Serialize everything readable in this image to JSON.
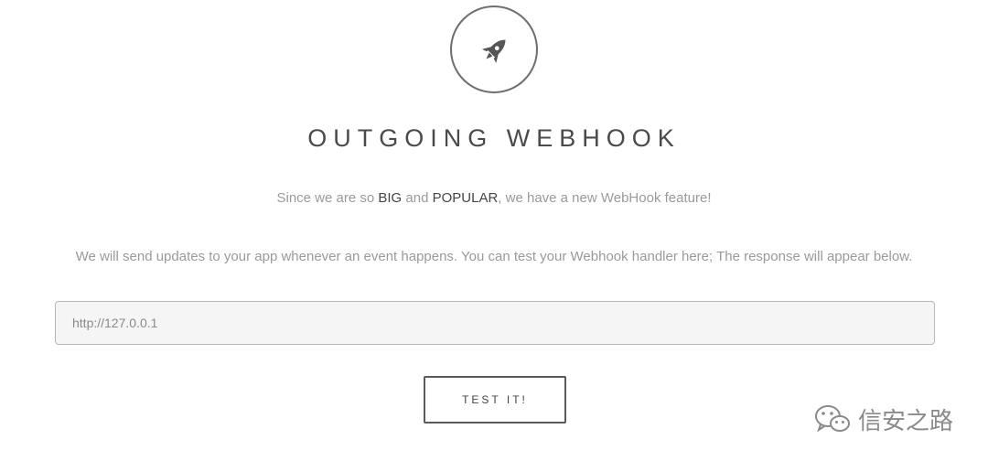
{
  "header": {
    "icon": "rocket-icon",
    "title": "OUTGOING WEBHOOK"
  },
  "intro": {
    "before_big": "Since we are so ",
    "big": "BIG",
    "and": " and ",
    "popular": "POPULAR",
    "after": ", we have a new WebHook feature!"
  },
  "description": "We will send updates to your app whenever an event happens. You can test your Webhook handler here; The response will appear below.",
  "form": {
    "url_value": "http://127.0.0.1",
    "test_button_label": "TEST IT!"
  },
  "watermark": {
    "icon": "wechat-icon",
    "text": "信安之路"
  }
}
